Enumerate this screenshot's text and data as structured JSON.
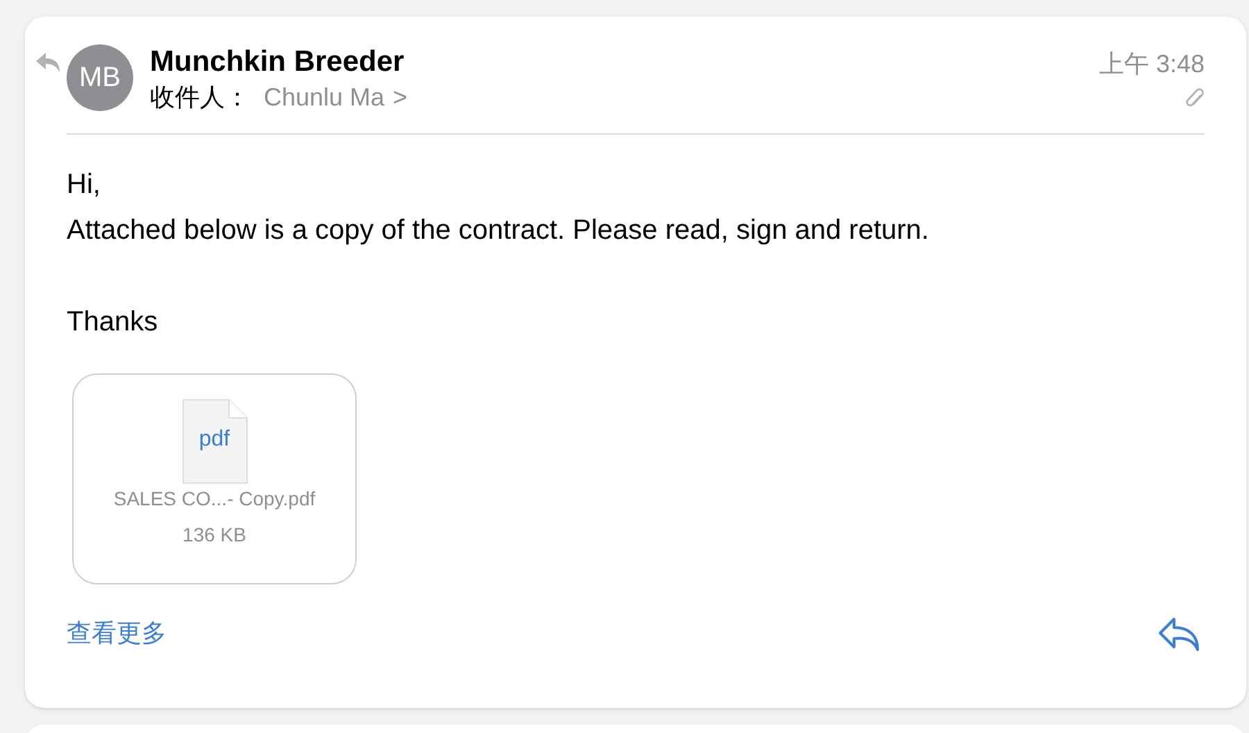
{
  "message": {
    "replied": true,
    "has_attachment": true,
    "avatar": "MB",
    "sender": "Munchkin Breeder",
    "to_label": "收件人：",
    "recipient": "Chunlu Ma",
    "chevron": ">",
    "time": "上午 3:48",
    "body": [
      "Hi,",
      "Attached below is a copy of the contract. Please read, sign and return."
    ],
    "closing": "Thanks",
    "attachment": {
      "type_label": "pdf",
      "filename": "SALES CO...- Copy.pdf",
      "size": "136 KB"
    },
    "see_more": "查看更多"
  }
}
